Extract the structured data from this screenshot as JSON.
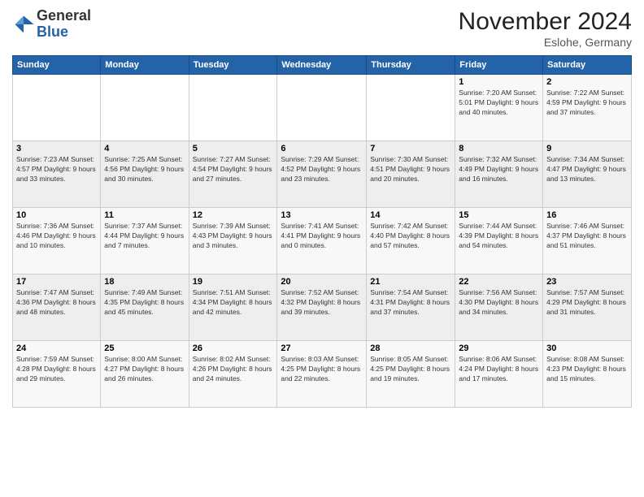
{
  "logo": {
    "general": "General",
    "blue": "Blue"
  },
  "title": "November 2024",
  "location": "Eslohe, Germany",
  "days_of_week": [
    "Sunday",
    "Monday",
    "Tuesday",
    "Wednesday",
    "Thursday",
    "Friday",
    "Saturday"
  ],
  "weeks": [
    [
      {
        "day": "",
        "info": ""
      },
      {
        "day": "",
        "info": ""
      },
      {
        "day": "",
        "info": ""
      },
      {
        "day": "",
        "info": ""
      },
      {
        "day": "",
        "info": ""
      },
      {
        "day": "1",
        "info": "Sunrise: 7:20 AM\nSunset: 5:01 PM\nDaylight: 9 hours and 40 minutes."
      },
      {
        "day": "2",
        "info": "Sunrise: 7:22 AM\nSunset: 4:59 PM\nDaylight: 9 hours and 37 minutes."
      }
    ],
    [
      {
        "day": "3",
        "info": "Sunrise: 7:23 AM\nSunset: 4:57 PM\nDaylight: 9 hours and 33 minutes."
      },
      {
        "day": "4",
        "info": "Sunrise: 7:25 AM\nSunset: 4:56 PM\nDaylight: 9 hours and 30 minutes."
      },
      {
        "day": "5",
        "info": "Sunrise: 7:27 AM\nSunset: 4:54 PM\nDaylight: 9 hours and 27 minutes."
      },
      {
        "day": "6",
        "info": "Sunrise: 7:29 AM\nSunset: 4:52 PM\nDaylight: 9 hours and 23 minutes."
      },
      {
        "day": "7",
        "info": "Sunrise: 7:30 AM\nSunset: 4:51 PM\nDaylight: 9 hours and 20 minutes."
      },
      {
        "day": "8",
        "info": "Sunrise: 7:32 AM\nSunset: 4:49 PM\nDaylight: 9 hours and 16 minutes."
      },
      {
        "day": "9",
        "info": "Sunrise: 7:34 AM\nSunset: 4:47 PM\nDaylight: 9 hours and 13 minutes."
      }
    ],
    [
      {
        "day": "10",
        "info": "Sunrise: 7:36 AM\nSunset: 4:46 PM\nDaylight: 9 hours and 10 minutes."
      },
      {
        "day": "11",
        "info": "Sunrise: 7:37 AM\nSunset: 4:44 PM\nDaylight: 9 hours and 7 minutes."
      },
      {
        "day": "12",
        "info": "Sunrise: 7:39 AM\nSunset: 4:43 PM\nDaylight: 9 hours and 3 minutes."
      },
      {
        "day": "13",
        "info": "Sunrise: 7:41 AM\nSunset: 4:41 PM\nDaylight: 9 hours and 0 minutes."
      },
      {
        "day": "14",
        "info": "Sunrise: 7:42 AM\nSunset: 4:40 PM\nDaylight: 8 hours and 57 minutes."
      },
      {
        "day": "15",
        "info": "Sunrise: 7:44 AM\nSunset: 4:39 PM\nDaylight: 8 hours and 54 minutes."
      },
      {
        "day": "16",
        "info": "Sunrise: 7:46 AM\nSunset: 4:37 PM\nDaylight: 8 hours and 51 minutes."
      }
    ],
    [
      {
        "day": "17",
        "info": "Sunrise: 7:47 AM\nSunset: 4:36 PM\nDaylight: 8 hours and 48 minutes."
      },
      {
        "day": "18",
        "info": "Sunrise: 7:49 AM\nSunset: 4:35 PM\nDaylight: 8 hours and 45 minutes."
      },
      {
        "day": "19",
        "info": "Sunrise: 7:51 AM\nSunset: 4:34 PM\nDaylight: 8 hours and 42 minutes."
      },
      {
        "day": "20",
        "info": "Sunrise: 7:52 AM\nSunset: 4:32 PM\nDaylight: 8 hours and 39 minutes."
      },
      {
        "day": "21",
        "info": "Sunrise: 7:54 AM\nSunset: 4:31 PM\nDaylight: 8 hours and 37 minutes."
      },
      {
        "day": "22",
        "info": "Sunrise: 7:56 AM\nSunset: 4:30 PM\nDaylight: 8 hours and 34 minutes."
      },
      {
        "day": "23",
        "info": "Sunrise: 7:57 AM\nSunset: 4:29 PM\nDaylight: 8 hours and 31 minutes."
      }
    ],
    [
      {
        "day": "24",
        "info": "Sunrise: 7:59 AM\nSunset: 4:28 PM\nDaylight: 8 hours and 29 minutes."
      },
      {
        "day": "25",
        "info": "Sunrise: 8:00 AM\nSunset: 4:27 PM\nDaylight: 8 hours and 26 minutes."
      },
      {
        "day": "26",
        "info": "Sunrise: 8:02 AM\nSunset: 4:26 PM\nDaylight: 8 hours and 24 minutes."
      },
      {
        "day": "27",
        "info": "Sunrise: 8:03 AM\nSunset: 4:25 PM\nDaylight: 8 hours and 22 minutes."
      },
      {
        "day": "28",
        "info": "Sunrise: 8:05 AM\nSunset: 4:25 PM\nDaylight: 8 hours and 19 minutes."
      },
      {
        "day": "29",
        "info": "Sunrise: 8:06 AM\nSunset: 4:24 PM\nDaylight: 8 hours and 17 minutes."
      },
      {
        "day": "30",
        "info": "Sunrise: 8:08 AM\nSunset: 4:23 PM\nDaylight: 8 hours and 15 minutes."
      }
    ]
  ]
}
